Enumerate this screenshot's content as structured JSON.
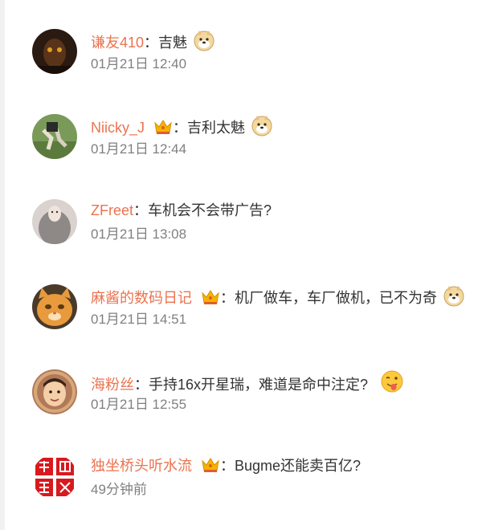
{
  "comments": [
    {
      "username": "谦友410",
      "colon": "：",
      "text": "吉魅",
      "emoji": "doge-emoji",
      "time": "01月21日 12:40",
      "crown": false,
      "avatar": "avatar-dark-portrait"
    },
    {
      "username": "Niicky_J",
      "colon": "：",
      "text": "吉利太魅",
      "emoji": "doge-emoji",
      "time": "01月21日 12:44",
      "crown": true,
      "avatar": "avatar-runner-photo"
    },
    {
      "username": "ZFreet",
      "colon": "：",
      "text": "车机会不会带广告?",
      "emoji": "",
      "time": "01月21日 13:08",
      "crown": false,
      "avatar": "avatar-grey-figure"
    },
    {
      "username": "麻酱的数码日记",
      "colon": "：",
      "text": "机厂做车，车厂做机，已不为奇",
      "emoji": "doge-emoji",
      "time": "01月21日 14:51",
      "crown": true,
      "avatar": "avatar-orange-cat"
    },
    {
      "username": "海粉丝",
      "colon": "：",
      "text": "手持16x开星瑞，难道是命中注定?",
      "emoji": "tongue-out-emoji",
      "time": "01月21日 12:55",
      "crown": false,
      "avatar": "avatar-baby-photo"
    },
    {
      "username": "独坐桥头听水流",
      "colon": "：",
      "text": "Bugme还能卖百亿?",
      "emoji": "",
      "time": "49分钟前",
      "crown": true,
      "avatar": "avatar-red-seal"
    }
  ],
  "colors": {
    "username": "#eb7350",
    "text": "#333333",
    "timestamp": "#808080",
    "crown": "#f5b400"
  }
}
